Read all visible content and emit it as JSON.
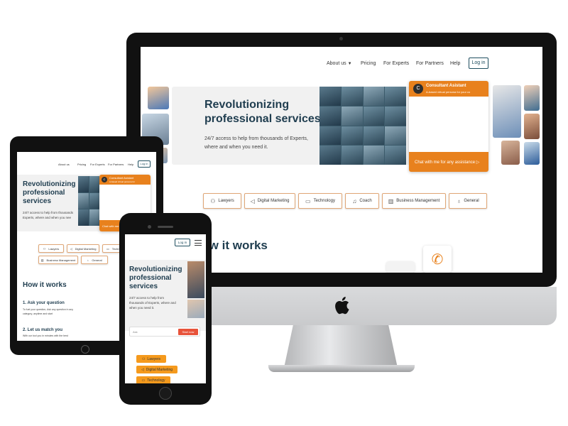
{
  "desktop": {
    "nav": {
      "about": "About us",
      "pricing": "Pricing",
      "experts": "For Experts",
      "partners": "For Partners",
      "help": "Help",
      "login": "Log in"
    },
    "hero": {
      "title_line1": "Revolutionizing",
      "title_line2": "professional services",
      "subtitle_line1": "24/7 access to help from thousands of Experts,",
      "subtitle_line2": "where and when you need it."
    },
    "chat": {
      "avatar_letter": "C",
      "title": "Consultant Asistant",
      "subtitle": "A-based virtual persona for your co",
      "cta": "Chat with me for any assistance"
    },
    "categories": [
      "Lawyers",
      "Digital Marketing",
      "Technology",
      "Coach",
      "Business Management",
      "General"
    ],
    "how_title": "How it works"
  },
  "tablet": {
    "nav": {
      "about": "About us",
      "pricing": "Pricing",
      "experts": "For Experts",
      "partners": "For Partners",
      "help": "Help",
      "login": "Log in"
    },
    "hero": {
      "title_line1": "Revolutionizing",
      "title_line2": "professional",
      "title_line3": "services",
      "subtitle_line1": "24/7 access to help from thousands",
      "subtitle_line2": "Experts, where and when you nee"
    },
    "chat": {
      "avatar_letter": "C",
      "title": "Consultant Asistant",
      "subtitle": "A-based virtual persona for",
      "cta": "Chat with me"
    },
    "categories": [
      "Lawyers",
      "Digital Marketing",
      "Technology",
      "Business Management",
      "General"
    ],
    "how_title": "How it works",
    "step1_title": "1. Ask your question",
    "step1_text_line1": "To fuel your question, Ask any question in any",
    "step1_text_line2": "category, anytime and start",
    "step2_title": "2. Let us match you",
    "step2_text": "With our tool you in minutes with the best"
  },
  "phone": {
    "login": "Log in",
    "hero": {
      "title_line1": "Revolutionizing",
      "title_line2": "professional",
      "title_line3": "services",
      "subtitle_line1": "24/7 access to help from",
      "subtitle_line2": "thousands of Experts, where and",
      "subtitle_line3": "when you need it."
    },
    "input_placeholder": "Ask",
    "start_button": "Start now",
    "categories": [
      "Lawyers",
      "Digital Marketing",
      "Technology"
    ]
  },
  "colors": {
    "brand_dark": "#1f3d4f",
    "accent_orange": "#e8811d",
    "start_red": "#e8533a"
  }
}
